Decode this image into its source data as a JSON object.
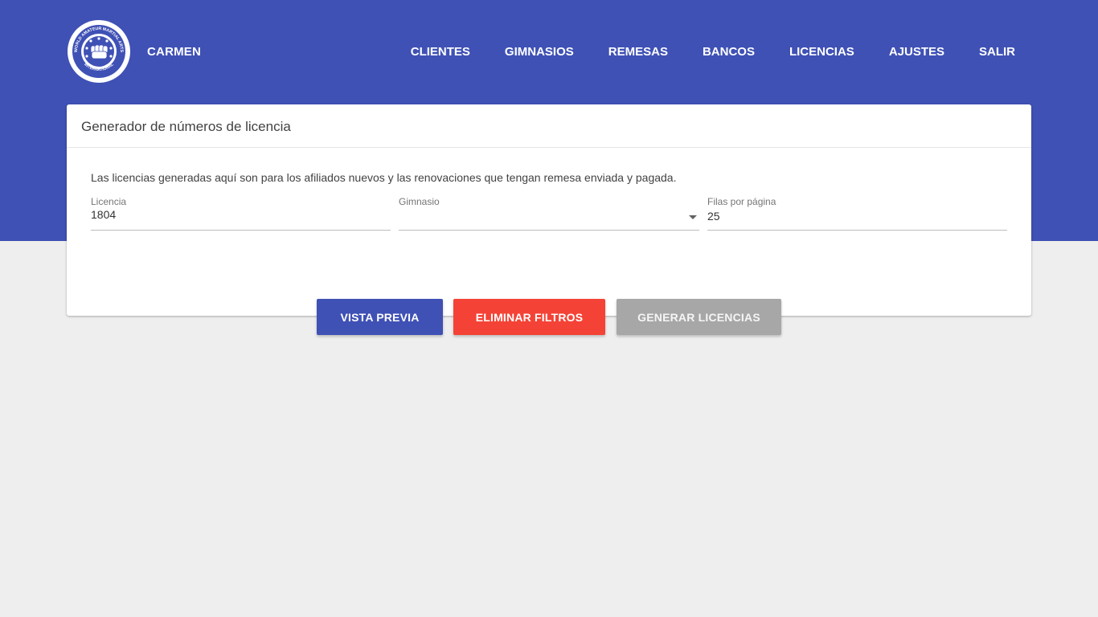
{
  "header": {
    "user_name": "CARMEN",
    "logo": {
      "icon": "fist-logo-icon",
      "text_top": "WORLD AMATEUR MARTIAL ARTS",
      "text_bottom": "INTERNATIONAL"
    },
    "nav": [
      {
        "label": "CLIENTES"
      },
      {
        "label": "GIMNASIOS"
      },
      {
        "label": "REMESAS"
      },
      {
        "label": "BANCOS"
      },
      {
        "label": "LICENCIAS"
      },
      {
        "label": "AJUSTES"
      },
      {
        "label": "SALIR"
      }
    ]
  },
  "card": {
    "title": "Generador de números de licencia",
    "info": "Las licencias generadas aquí son para los afiliados nuevos y las renovaciones que tengan remesa enviada y pagada.",
    "fields": {
      "license": {
        "label": "Licencia",
        "value": "1804"
      },
      "gym": {
        "label": "Gimnasio",
        "value": ""
      },
      "rows": {
        "label": "Filas por página",
        "value": "25"
      }
    },
    "buttons": {
      "preview": "VISTA PREVIA",
      "clear": "ELIMINAR FILTROS",
      "generate": "GENERAR LICENCIAS"
    }
  },
  "colors": {
    "primary": "#3f51b5",
    "danger": "#f44336",
    "disabled": "#a7a7a7",
    "background": "#eeeeee"
  }
}
